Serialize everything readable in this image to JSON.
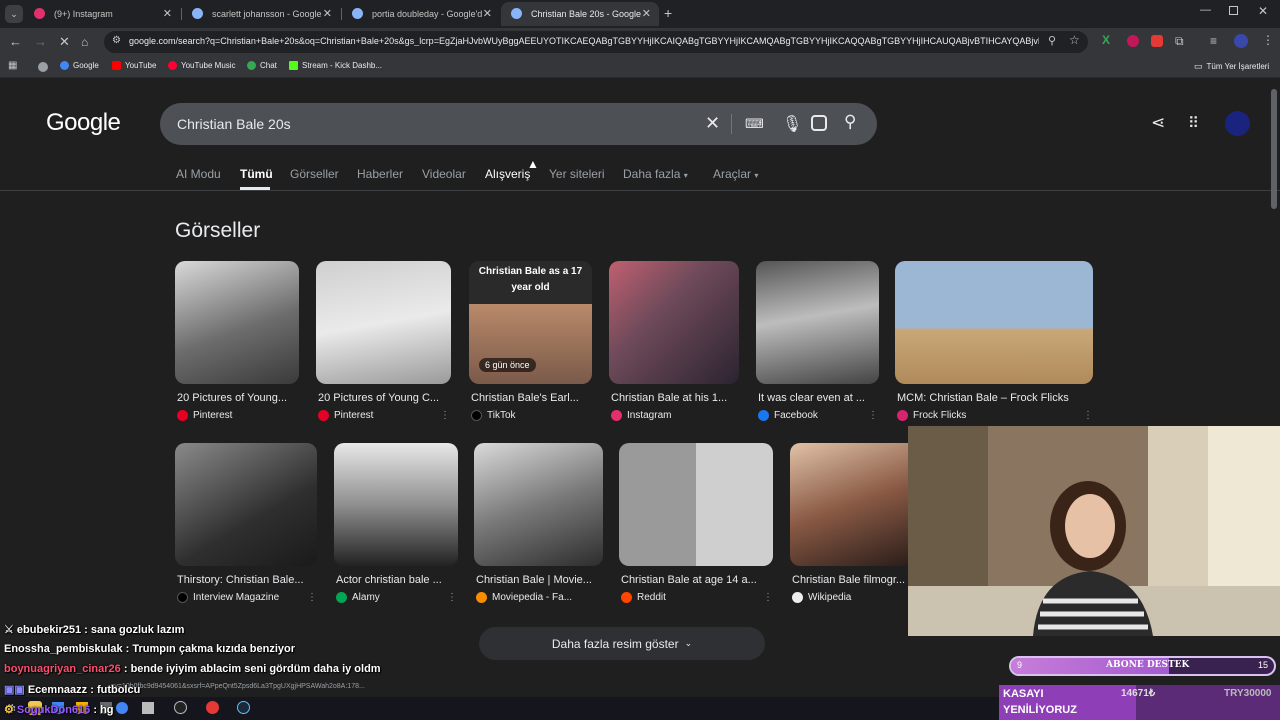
{
  "tabs": [
    {
      "label": "(9+) Instagram",
      "favicon_color": "#e1306c"
    },
    {
      "label": "scarlett johansson - Google'da...",
      "favicon_color": "#8ab4f8"
    },
    {
      "label": "portia doubleday - Google'da...",
      "favicon_color": "#8ab4f8"
    },
    {
      "label": "Christian Bale 20s - Google'da...",
      "favicon_color": "#8ab4f8"
    }
  ],
  "address_bar": {
    "url": "google.com/search?q=Christian+Bale+20s&oq=Christian+Bale+20s&gs_lcrp=EgZjaHJvbWUyBggAEEUYOTIKCAEQABgTGBYYHjIKCAIQABgTGBYYHjIKCAMQABgTGBYYHjIKCAQQABgTGBYYHjIHCAUQABjvBTIHCAYQABjvBTI..."
  },
  "bookmarks": [
    {
      "label": "Google",
      "color": "#4285f4"
    },
    {
      "label": "YouTube",
      "color": "#ff0000"
    },
    {
      "label": "YouTube Music",
      "color": "#ff0033"
    },
    {
      "label": "Chat",
      "color": "#34a853"
    },
    {
      "label": "Stream - Kick Dashb...",
      "color": "#53fc18"
    }
  ],
  "bookmarks_all": "Tüm Yer İşaretleri",
  "google": {
    "logo": "Google",
    "query": "Christian Bale 20s",
    "nav": [
      "AI Modu",
      "Tümü",
      "Görseller",
      "Haberler",
      "Videolar",
      "Alışveriş",
      "Yer siteleri",
      "Daha fazla",
      "Araçlar"
    ],
    "section_title": "Görseller",
    "more_images": "Daha fazla resim göster"
  },
  "images_row1": [
    {
      "title": "20 Pictures of Young...",
      "source": "Pinterest",
      "src_color": "#e60023"
    },
    {
      "title": "20 Pictures of Young C...",
      "source": "Pinterest",
      "src_color": "#e60023"
    },
    {
      "title": "Christian Bale's Earl...",
      "source": "TikTok",
      "src_color": "#000000",
      "overlay_text": "Christian Bale as a 17 year old",
      "badge": "6 gün önce"
    },
    {
      "title": "Christian Bale at his 1...",
      "source": "Instagram",
      "src_color": "#e1306c"
    },
    {
      "title": "It was clear even at ...",
      "source": "Facebook",
      "src_color": "#1877f2"
    },
    {
      "title": "MCM: Christian Bale – Frock Flicks",
      "source": "Frock Flicks",
      "src_color": "#d6246e"
    }
  ],
  "images_row2": [
    {
      "title": "Thirstory: Christian Bale...",
      "source": "Interview Magazine",
      "src_color": "#000000"
    },
    {
      "title": "Actor christian bale ...",
      "source": "Alamy",
      "src_color": "#00a651"
    },
    {
      "title": "Christian Bale | Movie...",
      "source": "Moviepedia - Fa...",
      "src_color": "#fa8c00"
    },
    {
      "title": "Christian Bale at age 14 a...",
      "source": "Reddit",
      "src_color": "#ff4500"
    },
    {
      "title": "Christian Bale filmogr...",
      "source": "Wikipedia",
      "src_color": "#eeeeee"
    }
  ],
  "chat": [
    {
      "user": "ebubekir251",
      "message": "sana gozluk lazım",
      "user_color": "#ffffff"
    },
    {
      "user": "Enossha_pembiskulak",
      "message": "Trumpın çakma kızıda benziyor",
      "user_color": "#ffffff"
    },
    {
      "user": "boynuagriyan_cinar26",
      "message": "bende iyiyim ablacim seni gördüm daha iy oldm",
      "user_color": "#ff4d6d"
    },
    {
      "user": "Ecemnaazz",
      "message": "futbolcu",
      "user_color": "#ffffff"
    },
    {
      "user": "SogukDon616",
      "message": "hg",
      "user_color": "#9b59ff"
    }
  ],
  "status_url": "...sv=10b0fbc9d9454061&sxsrf=APpeQnt5Zpsd6La3TpgUXgjHPSAWah2o8A:178...",
  "sub_goal": {
    "label": "ABONE DESTEK",
    "current": "9",
    "target": "15",
    "fraction": 0.6
  },
  "kasa": {
    "line1": "KASAYI",
    "line2": "YENİLİYORUZ",
    "amount": "14671₺",
    "target": "TRY30000"
  }
}
